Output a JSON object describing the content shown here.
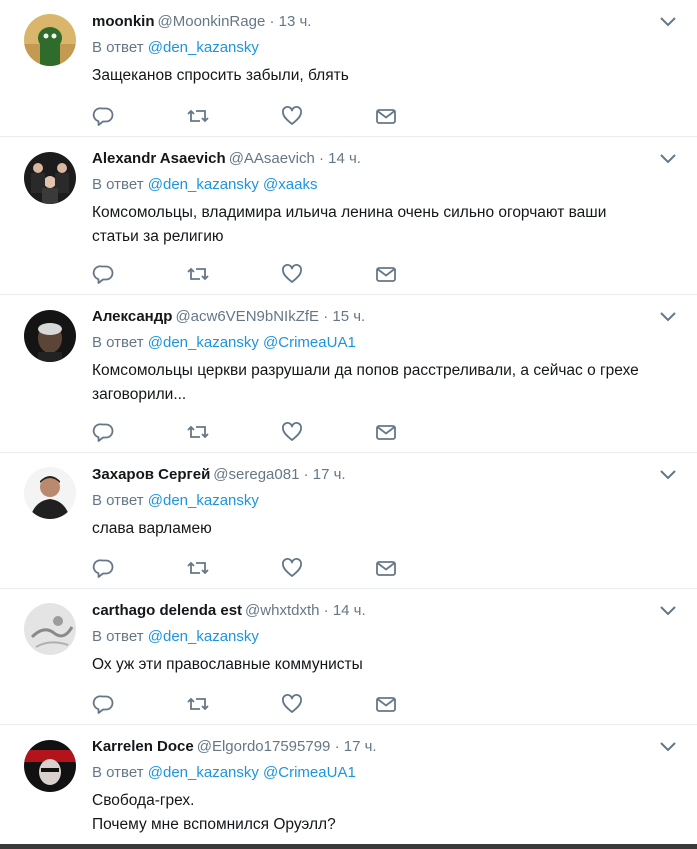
{
  "reply_prefix": "В ответ",
  "tweets": [
    {
      "name": "moonkin",
      "handle": "@MoonkinRage",
      "dot": "·",
      "time": "13 ч.",
      "mentions": [
        "@den_kazansky"
      ],
      "text_lines": [
        "Защеканов спросить забыли, блять"
      ],
      "avatar": "green-frog-avatar"
    },
    {
      "name": "Alexandr Asaevich",
      "handle": "@AAsaevich",
      "dot": "·",
      "time": "14 ч.",
      "mentions": [
        "@den_kazansky",
        "@xaaks"
      ],
      "text_lines": [
        "Комсомольцы, владимира ильича ленина очень сильно огорчают ваши",
        "статьи за религию"
      ],
      "avatar": "group-photo-avatar"
    },
    {
      "name": "Александр",
      "handle": "@acw6VEN9bNIkZfE",
      "dot": "·",
      "time": "15 ч.",
      "mentions": [
        "@den_kazansky",
        "@CrimeaUA1"
      ],
      "text_lines": [
        "Комсомольцы церкви разрушали да попов расстреливали, а сейчас о грехе",
        "заговорили..."
      ],
      "avatar": "portrait-avatar"
    },
    {
      "name": "Захаров Сергей",
      "handle": "@serega081",
      "dot": "·",
      "time": "17 ч.",
      "mentions": [
        "@den_kazansky"
      ],
      "text_lines": [
        "слава варламею"
      ],
      "avatar": "man-photo-avatar"
    },
    {
      "name": "carthago delenda est",
      "handle": "@whxtdxth",
      "dot": "·",
      "time": "14 ч.",
      "mentions": [
        "@den_kazansky"
      ],
      "text_lines": [
        "Ох уж эти православные коммунисты"
      ],
      "avatar": "grey-sketch-avatar"
    },
    {
      "name": "Karrelen Doce",
      "handle": "@Elgordo17595799",
      "dot": "·",
      "time": "17 ч.",
      "mentions": [
        "@den_kazansky",
        "@CrimeaUA1"
      ],
      "text_lines": [
        "Свобода-грех.",
        "Почему мне вспомнился Оруэлл?"
      ],
      "avatar": "dark-red-avatar"
    }
  ],
  "icons": {
    "reply": "reply-icon",
    "retweet": "retweet-icon",
    "like": "heart-icon",
    "message": "envelope-icon",
    "caret": "chevron-down-icon"
  },
  "colors": {
    "name": "#14171a",
    "meta": "#657786",
    "link": "#1b95e0",
    "divider": "#e6ecf0"
  }
}
